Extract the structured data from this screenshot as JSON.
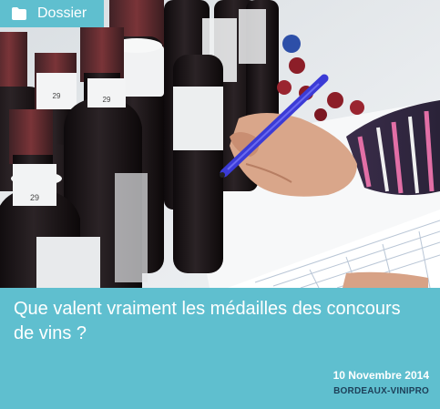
{
  "tag": {
    "label": "Dossier",
    "icon": "folder-icon"
  },
  "article": {
    "title": "Que valent vraiment les médailles des concours de vins ?",
    "date": "10 Novembre 2014",
    "source": "BORDEAUX-VINIPRO",
    "bottle_label_number": "29"
  },
  "colors": {
    "accent": "#5fbfcf",
    "source_text": "#1d3f58",
    "pen": "#3b3bd6"
  }
}
